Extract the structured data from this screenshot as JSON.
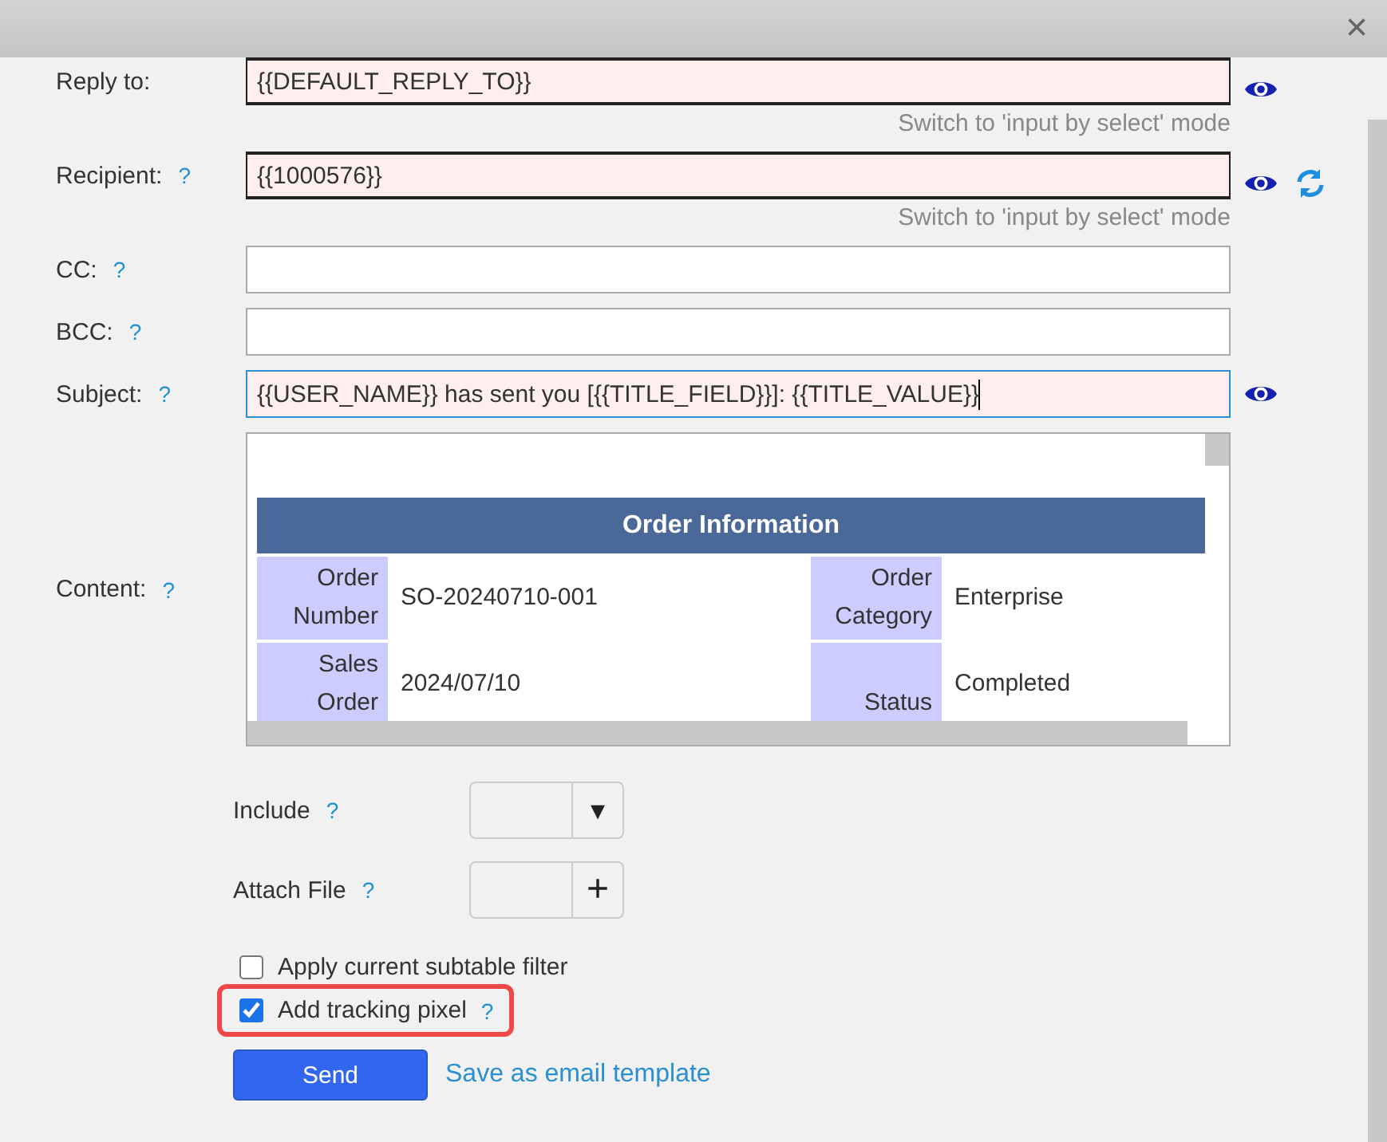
{
  "close": "×",
  "fields": [
    {
      "label": "Reply to:",
      "value": "{{DEFAULT_REPLY_TO}}",
      "filled": true,
      "focused": false,
      "preview": true,
      "refresh": false,
      "hint": "Switch to 'input by select' mode"
    },
    {
      "label": "Recipient:",
      "help": "?",
      "value": "{{1000576}}",
      "filled": true,
      "focused": false,
      "preview": true,
      "refresh": true,
      "hint": "Switch to 'input by select' mode"
    },
    {
      "label": "CC:",
      "help": "?",
      "filled": false,
      "focused": false,
      "preview": false,
      "refresh": false
    },
    {
      "label": "BCC:",
      "help": "?",
      "filled": false,
      "focused": false,
      "preview": false,
      "refresh": false
    },
    {
      "label": "Subject:",
      "help": "?",
      "value": "{{USER_NAME}} has sent you [{{TITLE_FIELD}}]: {{TITLE_VALUE}}",
      "filled": true,
      "focused": true,
      "preview": true,
      "refresh": false
    }
  ],
  "content": {
    "label": "Content:",
    "help": "?",
    "table_title": "Order Information",
    "rows": [
      [
        "Order Number",
        "SO-20240710-001",
        "Order Category",
        "Enterprise"
      ],
      [
        "Sales Order",
        "2024/07/10",
        "Status",
        "Completed"
      ]
    ]
  },
  "pickers": [
    {
      "kind": "dropdown",
      "label": "Include",
      "help": "?",
      "action": "▾"
    },
    {
      "kind": "add",
      "label": "Attach File",
      "help": "?",
      "action": "+"
    }
  ],
  "options": [
    {
      "label": "Apply current subtable filter",
      "checked": false,
      "highlighted": false
    },
    {
      "label": "Add tracking pixel",
      "help": "?",
      "checked": true,
      "highlighted": true
    }
  ],
  "send": "Send",
  "save_template": "Save as email template"
}
